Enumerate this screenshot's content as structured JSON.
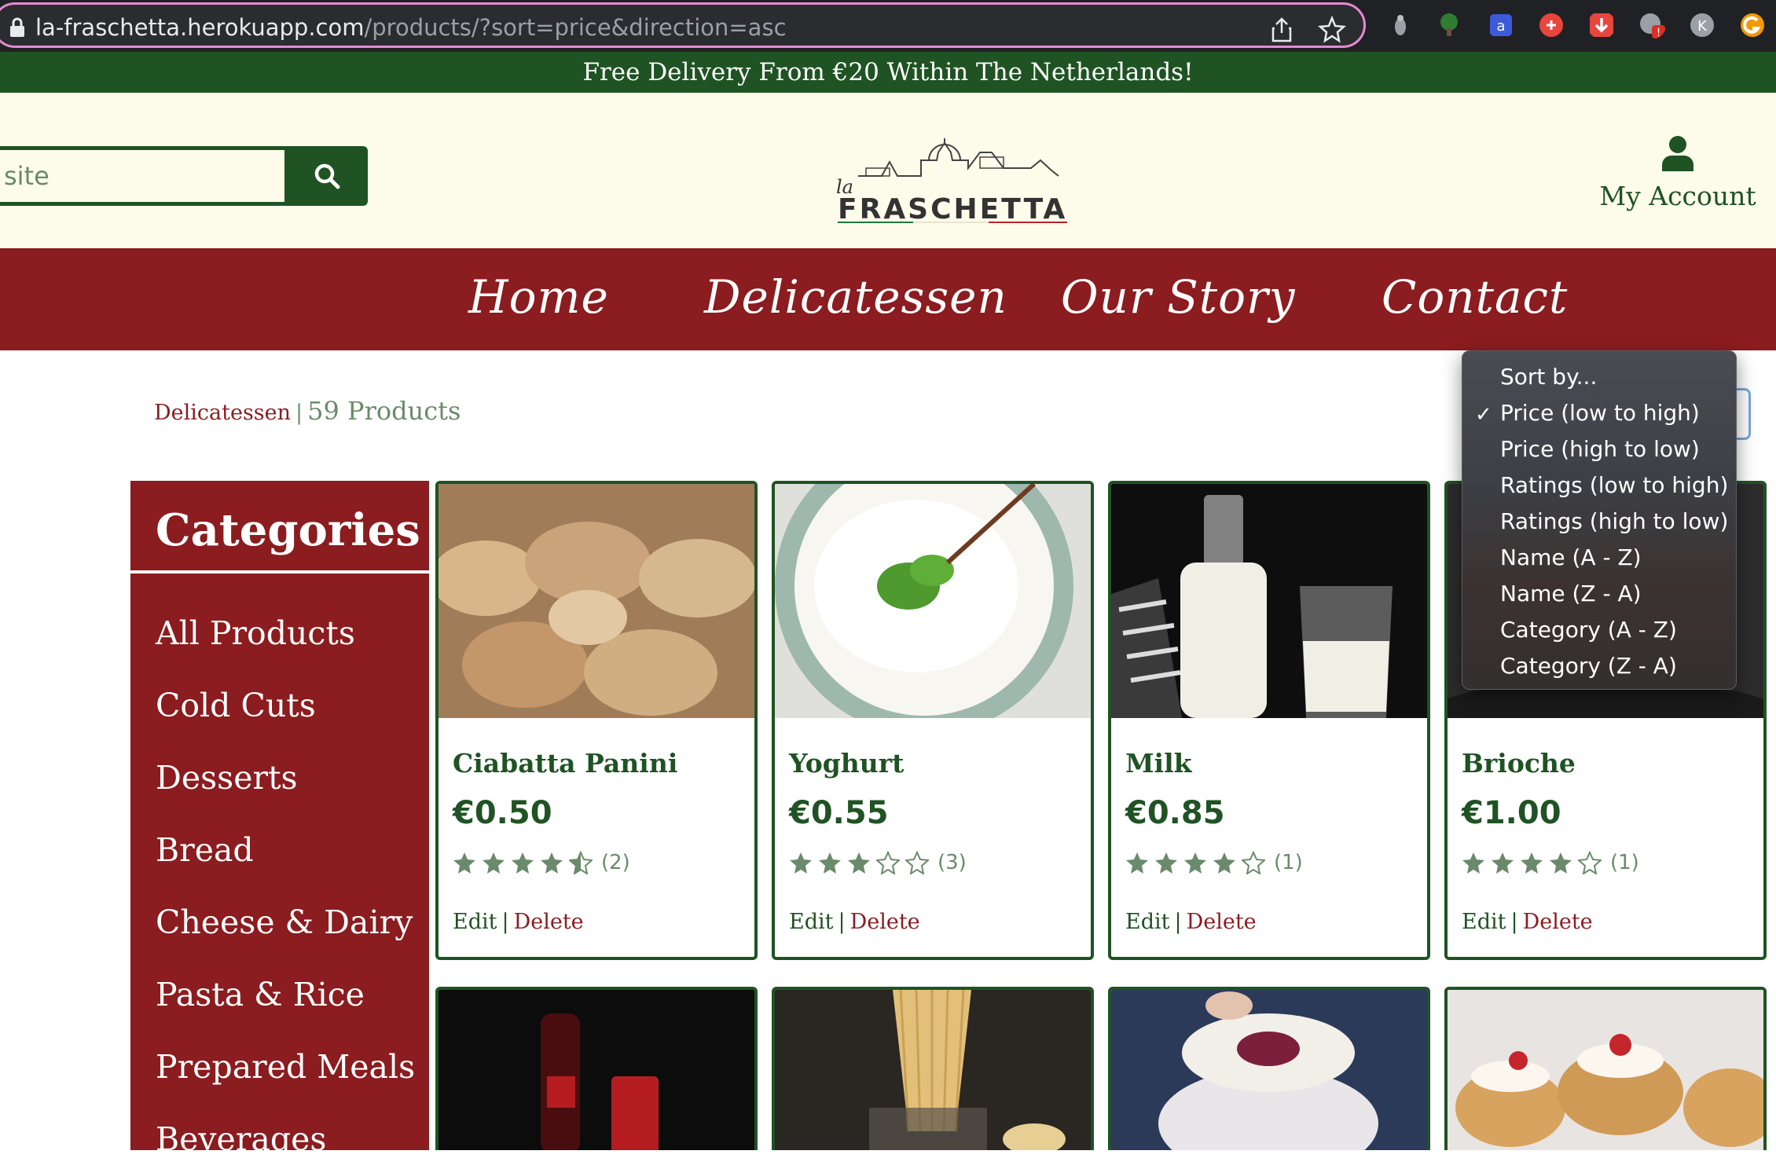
{
  "browser": {
    "url_host": "la-fraschetta.herokuapp.com",
    "url_path": "/products/?sort=price&direction=asc",
    "extension_badge": "!",
    "profile_initial": "K"
  },
  "promo": {
    "text": "Free Delivery From €20 Within The Netherlands!"
  },
  "header": {
    "search_placeholder": "site",
    "logo_script": "la",
    "logo_text": "FRASCHETTA",
    "account_label": "My Account"
  },
  "nav": {
    "items": [
      "Home",
      "Delicatessen",
      "Our Story",
      "Contact"
    ]
  },
  "breadcrumb": {
    "category": "Delicatessen",
    "separator": "|",
    "count": "59 Products"
  },
  "sidebar": {
    "title": "Categories",
    "items": [
      "All Products",
      "Cold Cuts",
      "Desserts",
      "Bread",
      "Cheese & Dairy",
      "Pasta & Rice",
      "Prepared Meals",
      "Beverages"
    ]
  },
  "products": [
    {
      "name": "Ciabatta Panini",
      "price": "€0.50",
      "rating": 4.5,
      "count": "(2)"
    },
    {
      "name": "Yoghurt",
      "price": "€0.55",
      "rating": 3,
      "count": "(3)"
    },
    {
      "name": "Milk",
      "price": "€0.85",
      "rating": 4,
      "count": "(1)"
    },
    {
      "name": "Brioche",
      "price": "€1.00",
      "rating": 4,
      "count": "(1)"
    }
  ],
  "actions": {
    "edit": "Edit",
    "delete": "Delete",
    "separator": "|"
  },
  "sort": {
    "options": [
      "Sort by...",
      "Price (low to high)",
      "Price (high to low)",
      "Ratings (low to high)",
      "Ratings (high to low)",
      "Name (A - Z)",
      "Name (Z - A)",
      "Category (A - Z)",
      "Category (Z - A)"
    ],
    "selected": "Price (low to high)",
    "check": "✓"
  },
  "colors": {
    "brand_green": "#1f5323",
    "brand_red": "#8b1c1f",
    "header_bg": "#fdfbea",
    "muted_green": "#6a8a6c"
  }
}
